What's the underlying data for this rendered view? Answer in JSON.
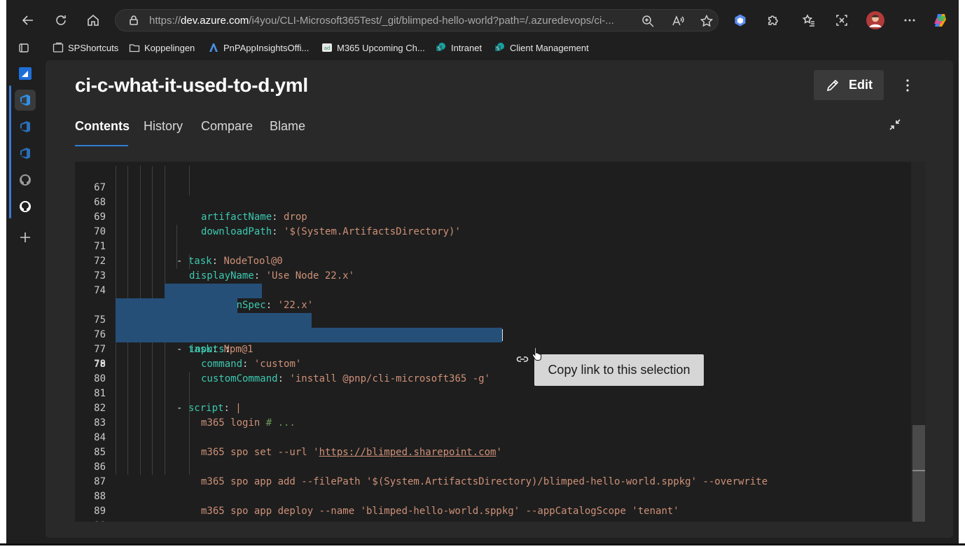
{
  "browser": {
    "url_prefix": "https://",
    "url_domain": "dev.azure.com",
    "url_path": "/i4you/CLI-Microsoft365Test/_git/blimped-hello-world?path=/.azuredevops/ci-..."
  },
  "favorites": [
    {
      "label": "SPShortcuts",
      "icon": "collection-icon"
    },
    {
      "label": "Koppelingen",
      "icon": "folder-icon"
    },
    {
      "label": "PnPAppInsightsOffi...",
      "icon": "app-icon"
    },
    {
      "label": "M365 Upcoming Ch...",
      "icon": "ad-icon"
    },
    {
      "label": "Intranet",
      "icon": "sharepoint-icon"
    },
    {
      "label": "Client Management",
      "icon": "sharepoint-icon"
    }
  ],
  "page": {
    "title": "ci-c-what-it-used-to-d.yml",
    "edit_label": "Edit",
    "tabs": [
      "Contents",
      "History",
      "Compare",
      "Blame"
    ],
    "active_tab": "Contents"
  },
  "editor": {
    "current_line": "78",
    "line_numbers": [
      "67",
      "68",
      "69",
      "70",
      "71",
      "72",
      "73",
      "74",
      "75",
      "76",
      "77",
      "78",
      "79",
      "80",
      "81",
      "82",
      "83",
      "84",
      "85",
      "86",
      "87",
      "88",
      "89",
      "90"
    ],
    "code": {
      "l67": {
        "key": "artifactName",
        "sep": ": ",
        "val": "drop"
      },
      "l68": {
        "key": "downloadPath",
        "sep": ": ",
        "val": "'$(System.ArtifactsDirectory)'"
      },
      "l70": {
        "dash": "- ",
        "key": "task",
        "sep": ": ",
        "val": "NodeTool@0"
      },
      "l71": {
        "key": "displayName",
        "sep": ": ",
        "val": "'Use Node 22.x'"
      },
      "l72": {
        "key": "inputs",
        "sep": ":"
      },
      "l73": {
        "key": "versionSpec",
        "sep": ": ",
        "val": "'22.x'"
      },
      "l75": {
        "dash": "- ",
        "key": "task",
        "sep": ": ",
        "val": "Npm@1"
      },
      "l76": {
        "key": "inputs",
        "sep": ":"
      },
      "l77": {
        "key": "command",
        "sep": ": ",
        "val": "'custom'"
      },
      "l78": {
        "key": "customCommand",
        "sep": ": ",
        "val": "'install @pnp/cli-microsoft365 -g'"
      },
      "l80": {
        "dash": "- ",
        "key": "script",
        "sep": ": ",
        "val": "|"
      },
      "l81": {
        "val": "m365 login ",
        "comment": "# ..."
      },
      "l83": {
        "val": "m365 spo set --url '",
        "link": "https://blimped.sharepoint.com",
        "tail": "'"
      },
      "l85": {
        "val": "m365 spo app add --filePath '$(System.ArtifactsDirectory)/blimped-hello-world.sppkg' --overwrite"
      },
      "l87": {
        "val": "m365 spo app deploy --name 'blimped-hello-world.sppkg' --appCatalogScope 'tenant'"
      }
    }
  },
  "tooltip": {
    "text": "Copy link to this selection"
  },
  "colors": {
    "accent": "#2f7fd6",
    "selection": "#264f78",
    "yaml_key": "#3dc9b0",
    "yaml_string": "#ce9178"
  }
}
